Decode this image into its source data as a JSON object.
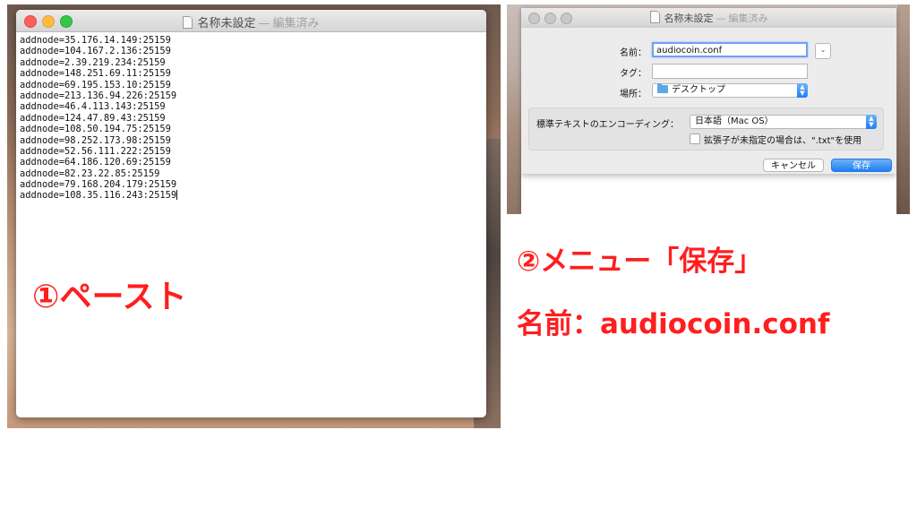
{
  "editor_window": {
    "title": "名称未設定",
    "separator": "—",
    "status": "編集済み",
    "lines": [
      "addnode=35.176.14.149:25159",
      "addnode=104.167.2.136:25159",
      "addnode=2.39.219.234:25159",
      "addnode=148.251.69.11:25159",
      "addnode=69.195.153.10:25159",
      "addnode=213.136.94.226:25159",
      "addnode=46.4.113.143:25159",
      "addnode=124.47.89.43:25159",
      "addnode=108.50.194.75:25159",
      "addnode=98.252.173.98:25159",
      "addnode=52.56.111.222:25159",
      "addnode=64.186.120.69:25159",
      "addnode=82.23.22.85:25159",
      "addnode=79.168.204.179:25159",
      "addnode=108.35.116.243:25159"
    ]
  },
  "annotations": {
    "paste": "①ペースト",
    "menu_save": "②メニュー「保存」",
    "filename": "名前：audiocoin.conf"
  },
  "save_dialog": {
    "window_title": "名称未設定",
    "window_separator": "—",
    "window_status": "編集済み",
    "name_label": "名前：",
    "name_value": "audiocoin.conf",
    "tags_label": "タグ：",
    "tags_value": "",
    "location_label": "場所：",
    "location_value": "デスクトップ",
    "encoding_label": "標準テキストのエンコーディング：",
    "encoding_value": "日本語（Mac OS）",
    "extension_checkbox_label": "拡張子が未指定の場合は、\".txt\"を使用",
    "extension_checked": false,
    "cancel_label": "キャンセル",
    "save_label": "保存"
  },
  "icons": {
    "document": "document-icon",
    "folder": "folder-icon",
    "expand": "chevron-down-icon",
    "popup": "up-down-arrows-icon"
  },
  "colors": {
    "annotation": "#ff1e1e",
    "accent_blue": "#1f7ef3"
  }
}
